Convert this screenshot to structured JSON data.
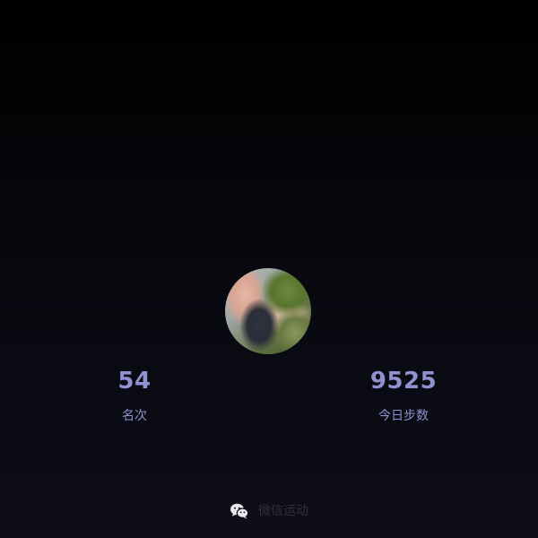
{
  "profile": {
    "avatar_icon": "avatar-photo"
  },
  "stats": {
    "rank": {
      "value": "54",
      "label": "名次"
    },
    "steps": {
      "value": "9525",
      "label": "今日步数"
    }
  },
  "footer": {
    "brand_label": "微信运动",
    "icon": "wechat-icon"
  },
  "colors": {
    "accent": "#8f91d0",
    "footer_text": "#303140",
    "background_top": "#000000",
    "background_bottom": "#0e0e1a"
  }
}
